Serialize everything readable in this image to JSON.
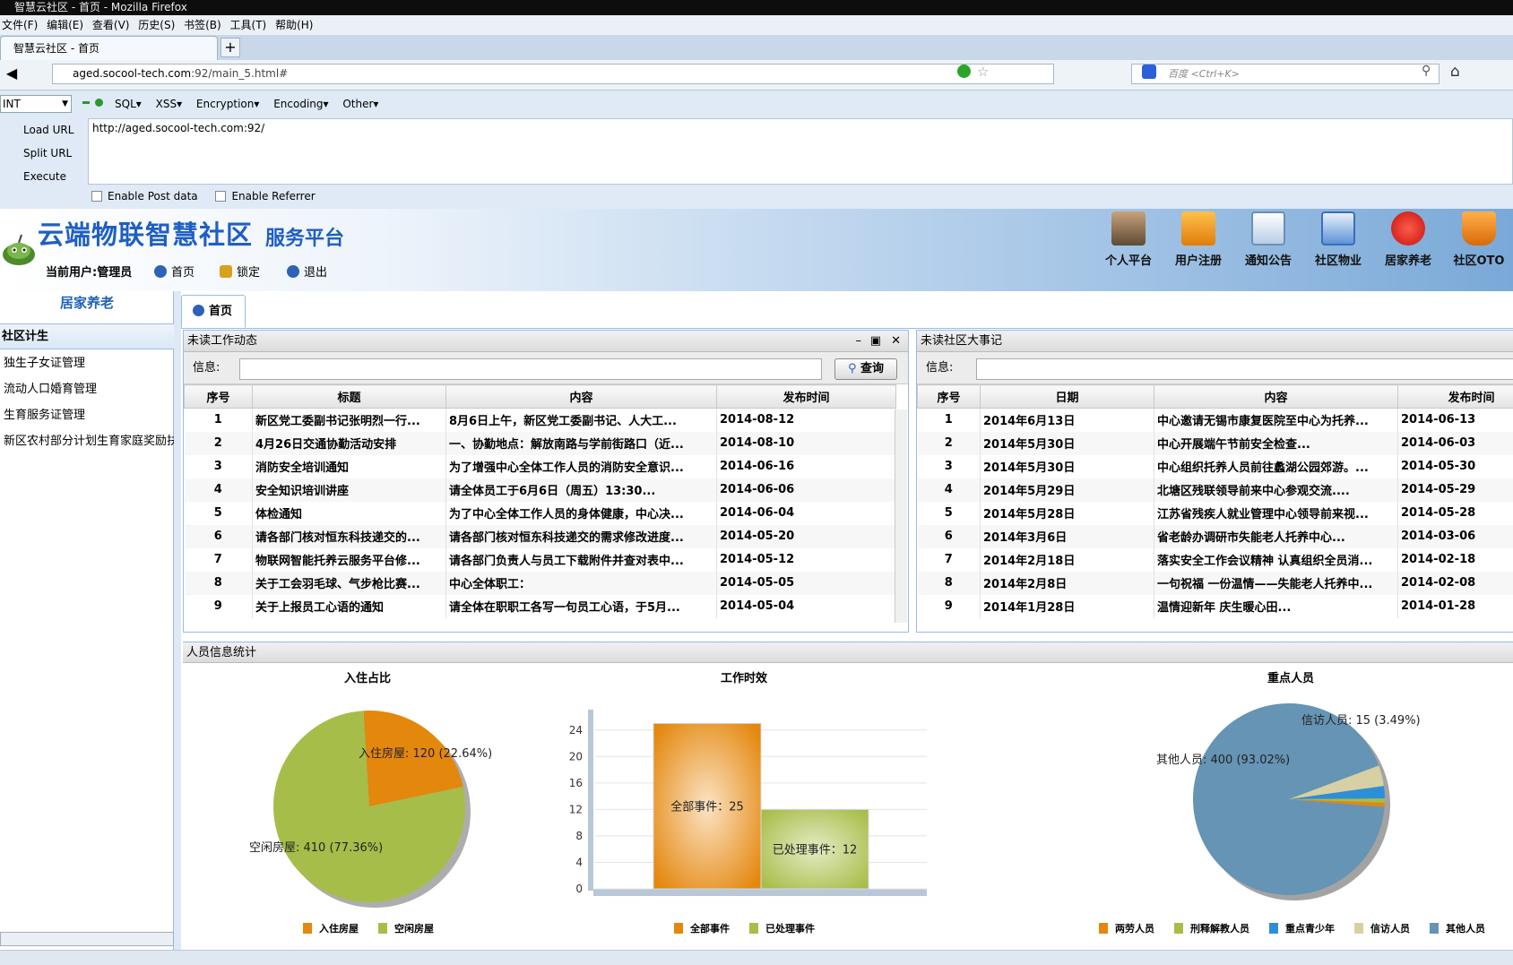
{
  "window": {
    "title": "智慧云社区 - 首页 - Mozilla Firefox"
  },
  "menubar": [
    "文件(F)",
    "编辑(E)",
    "查看(V)",
    "历史(S)",
    "书签(B)",
    "工具(T)",
    "帮助(H)"
  ],
  "browser_tab": {
    "label": "智慧云社区 - 首页",
    "new_tab": "+"
  },
  "address": {
    "host": "aged.socool-tech.com",
    "rest": ":92/main_5.html#"
  },
  "search": {
    "placeholder": "百度 <Ctrl+K>"
  },
  "hackbar": {
    "select": "INT",
    "menus": [
      "SQL▾",
      "XSS▾",
      "Encryption▾",
      "Encoding▾",
      "Other▾"
    ],
    "tools": [
      "Load URL",
      "Split URL",
      "Execute"
    ],
    "url_value": "http://aged.socool-tech.com:92/",
    "options": [
      "Enable Post data",
      "Enable Referrer"
    ]
  },
  "header": {
    "title": "云端物联智慧社区",
    "subtitle": "服务平台",
    "current_user": "当前用户:管理员",
    "links": [
      "首页",
      "锁定",
      "退出"
    ],
    "nav": [
      {
        "label": "个人平台",
        "icon": "person-icon",
        "color": "#6b4a2a"
      },
      {
        "label": "用户注册",
        "icon": "wallet-icon",
        "color": "#e98a12"
      },
      {
        "label": "通知公告",
        "icon": "notice-board-icon",
        "color": "#5a8ac6"
      },
      {
        "label": "社区物业",
        "icon": "document-icon",
        "color": "#3a7ad6"
      },
      {
        "label": "居家养老",
        "icon": "red-seal-icon",
        "color": "#d8241f"
      },
      {
        "label": "社区OTO",
        "icon": "shopping-cart-icon",
        "color": "#e07a10"
      }
    ]
  },
  "sidebar": {
    "title": "居家养老",
    "section": "社区计生",
    "items": [
      "独生子女证管理",
      "流动人口婚育管理",
      "生育服务证管理",
      "新区农村部分计划生育家庭奖励扶"
    ]
  },
  "main_tab": "首页",
  "work_panel": {
    "title": "未读工作动态",
    "search_label": "信息:",
    "search_button": "查询",
    "columns": [
      "序号",
      "标题",
      "内容",
      "发布时间"
    ],
    "rows": [
      [
        "1",
        "新区党工委副书记张明烈一行...",
        "8月6日上午，新区党工委副书记、人大工...",
        "2014-08-12"
      ],
      [
        "2",
        "4月26日交通协勤活动安排",
        "一、协勤地点：解放南路与学前街路口（近...",
        "2014-08-10"
      ],
      [
        "3",
        "消防安全培训通知",
        "为了增强中心全体工作人员的消防安全意识...",
        "2014-06-16"
      ],
      [
        "4",
        "安全知识培训讲座",
        "请全体员工于6月6日（周五）13:30...",
        "2014-06-06"
      ],
      [
        "5",
        "体检通知",
        "为了中心全体工作人员的身体健康，中心决...",
        "2014-06-04"
      ],
      [
        "6",
        "请各部门核对恒东科技递交的...",
        "请各部门核对恒东科技递交的需求修改进度...",
        "2014-05-20"
      ],
      [
        "7",
        "物联网智能托养云服务平台修...",
        "请各部门负责人与员工下载附件并查对表中...",
        "2014-05-12"
      ],
      [
        "8",
        "关于工会羽毛球、气步枪比赛...",
        "中心全体职工：",
        "2014-05-05"
      ],
      [
        "9",
        "关于上报员工心语的通知",
        "请全体在职职工各写一句员工心语，于5月...",
        "2014-05-04"
      ]
    ]
  },
  "events_panel": {
    "title": "未读社区大事记",
    "search_label": "信息:",
    "columns": [
      "序号",
      "日期",
      "内容",
      "发布时间"
    ],
    "rows": [
      [
        "1",
        "2014年6月13日",
        "中心邀请无锡市康复医院至中心为托养...",
        "2014-06-13"
      ],
      [
        "2",
        "2014年5月30日",
        "中心开展端午节前安全检查...",
        "2014-06-03"
      ],
      [
        "3",
        "2014年5月30日",
        "中心组织托养人员前往蠡湖公园郊游。...",
        "2014-05-30"
      ],
      [
        "4",
        "2014年5月29日",
        "北塘区残联领导前来中心参观交流....",
        "2014-05-29"
      ],
      [
        "5",
        "2014年5月28日",
        "江苏省残疾人就业管理中心领导前来视...",
        "2014-05-28"
      ],
      [
        "6",
        "2014年3月6日",
        "省老龄办调研市失能老人托养中心...",
        "2014-03-06"
      ],
      [
        "7",
        "2014年2月18日",
        "落实安全工作会议精神 认真组织全员消...",
        "2014-02-18"
      ],
      [
        "8",
        "2014年2月8日",
        "一句祝福 一份温情——失能老人托养中...",
        "2014-02-08"
      ],
      [
        "9",
        "2014年1月28日",
        "温情迎新年 庆生暖心田...",
        "2014-01-28"
      ]
    ]
  },
  "stats": {
    "title": "人员信息统计"
  },
  "chart_data": [
    {
      "type": "pie",
      "title": "入住占比",
      "labels": [
        "入住房屋",
        "空闲房屋"
      ],
      "values": [
        120,
        410
      ],
      "percent": [
        22.64,
        77.36
      ],
      "slice_labels": [
        "入住房屋: 120 (22.64%)",
        "空闲房屋: 410 (77.36%)"
      ],
      "colors": [
        "#e4870d",
        "#a7bd4a"
      ],
      "legend": "bottom"
    },
    {
      "type": "bar",
      "title": "工作时效",
      "categories": [
        "全部事件",
        "已处理事件"
      ],
      "values": [
        25,
        12
      ],
      "bar_labels": [
        "全部事件：25",
        "已处理事件：12"
      ],
      "yticks": [
        "0",
        "4",
        "8",
        "12",
        "16",
        "20",
        "24"
      ],
      "ylim": [
        0,
        26
      ],
      "grid": true,
      "colors": [
        "#e4870d",
        "#a7bd4a"
      ],
      "legend": "bottom"
    },
    {
      "type": "pie",
      "title": "重点人员",
      "labels": [
        "两劳人员",
        "刑释解教人员",
        "重点青少年",
        "信访人员",
        "其他人员"
      ],
      "values": [
        3,
        3,
        9,
        15,
        400
      ],
      "slice_labels": [
        "信访人员: 15 (3.49%)",
        "其他人员: 400 (93.02%)"
      ],
      "colors": [
        "#e4870d",
        "#a7bd4a",
        "#2d8fd8",
        "#d6d0a4",
        "#6594b4"
      ],
      "legend": "bottom"
    }
  ]
}
